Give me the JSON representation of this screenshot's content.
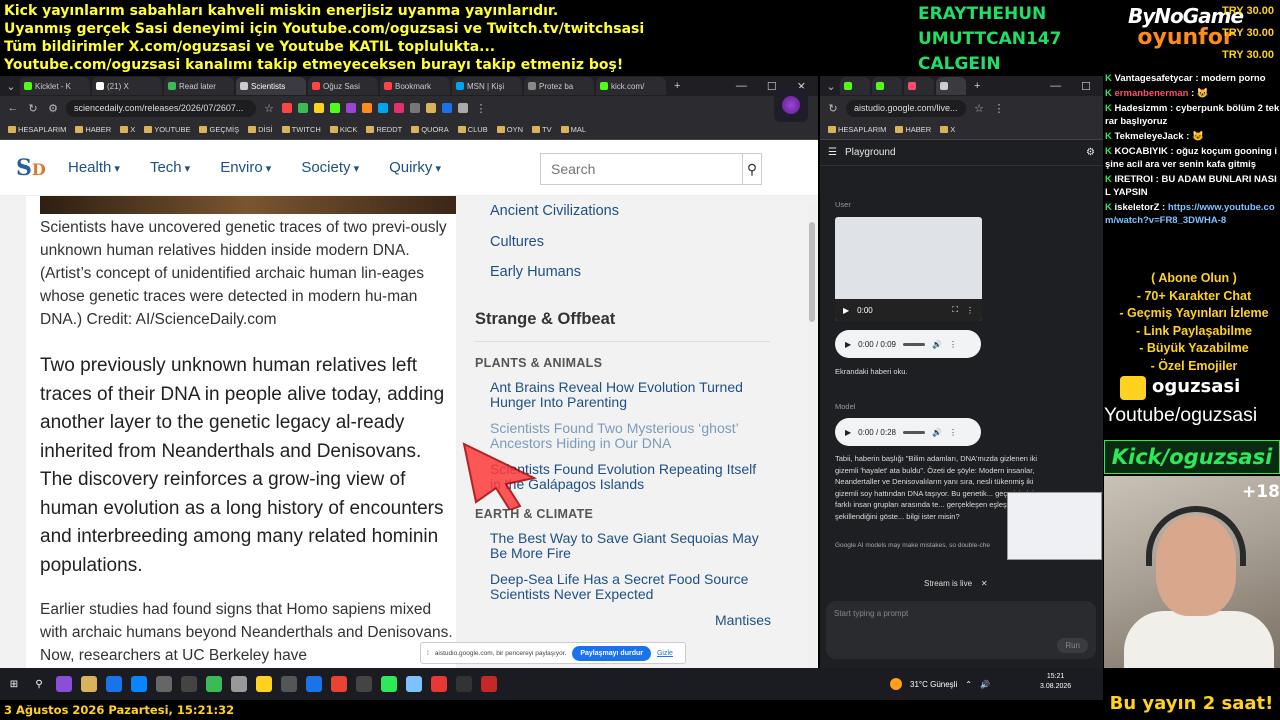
{
  "banner": {
    "lines": [
      "Kick yayınlarım sabahları kahveli miskin enerjisiz uyanma yayınlarıdır.",
      "Uyanmış gerçek Sasi deneyimi için Youtube.com/oguzsasi ve Twitch.tv/twitchsasi",
      "Tüm bildirimler X.com/oguzsasi ve Youtube KATIL toplulukta...",
      "Youtube.com/oguzsasi kanalımı takip etmeyeceksen burayı takip etmeniz boş!"
    ]
  },
  "subscribers": [
    "ERAYTHEHUN",
    "UMUTTCAN147",
    "CALGEIN"
  ],
  "brand": {
    "top": "ByNoGame",
    "bottom": "oyunfor"
  },
  "donations": [
    "TRY 30.00",
    "TRY 30.00",
    "TRY 30.00"
  ],
  "left_browser": {
    "tabs": [
      {
        "label": "Kicklet - K",
        "color": "#53fc18"
      },
      {
        "label": "(21) X",
        "color": "#ffffff"
      },
      {
        "label": "Read later",
        "color": "#3cba54"
      },
      {
        "label": "Scientists",
        "color": "#cccccc",
        "active": true
      },
      {
        "label": "Oğuz Sasi",
        "color": "#ff4444"
      },
      {
        "label": "Bookmark",
        "color": "#ff4444"
      },
      {
        "label": "MSN | Kişi",
        "color": "#00a4ef"
      },
      {
        "label": "Protez ba",
        "color": "#888888"
      },
      {
        "label": "kick.com/",
        "color": "#53fc18"
      }
    ],
    "url": "sciencedaily.com/releases/2026/07/2607...",
    "bookmarks": [
      "HESAPLARIM",
      "HABER",
      "X",
      "YOUTUBE",
      "GEÇMİŞ",
      "DİSİ",
      "TWITCH",
      "KICK",
      "REDDT",
      "QUORA",
      "CLUB",
      "OYN",
      "TV",
      "MAL"
    ]
  },
  "site": {
    "logo_s": "S",
    "logo_d": "D",
    "nav": [
      "Health",
      "Tech",
      "Enviro",
      "Society",
      "Quirky"
    ],
    "search_placeholder": "Search",
    "caption": "Scientists have uncovered genetic traces of two previ-ously unknown human relatives hidden inside modern DNA. (Artist’s concept of unidentified archaic human lin-eages whose genetic traces were detected in modern hu-man DNA.) Credit: AI/ScienceDaily.com",
    "lead": "Two previously unknown human relatives left traces of their DNA in people alive today, adding another layer to the genetic legacy al-ready inherited from Neanderthals and Denisovans. The discovery reinforces a grow-ing view of human evolution as a long history of encounters and interbreeding among many related hominin populations.",
    "body": "Earlier studies had found signs that Homo sapiens mixed with archaic humans beyond Neanderthals and Denisovans. Now, researchers at UC Berkeley have",
    "topic_links": [
      "Ancient Civilizations",
      "Cultures",
      "Early Humans"
    ],
    "section_title": "Strange & Offbeat",
    "plants_heading": "PLANTS & ANIMALS",
    "plants_links": [
      "Ant Brains Reveal How Evolution Turned Hunger Into Parenting",
      "Scientists Found Two Mysterious ‘ghost’ Ancestors Hiding in Our DNA",
      "Scientists Found Evolution Repeating Itself in the Galápagos Islands"
    ],
    "earth_heading": "EARTH & CLIMATE",
    "earth_links": [
      "The Best Way to Save Giant Sequoias May Be More Fire",
      "Deep-Sea Life Has a Secret Food Source Scientists Never Expected",
      "Mantises"
    ]
  },
  "share_bar": {
    "text": "aistudio.google.com, bir pencereyi paylaşıyor.",
    "stop_label": "Paylaşmayı durdur",
    "hide_label": "Gizle"
  },
  "right_browser": {
    "url": "aistudio.google.com/live...",
    "bookmarks": [
      "HESAPLARIM",
      "HABER",
      "X"
    ],
    "title": "Playground",
    "user_label": "User",
    "video_time": "0:00",
    "audio1_time": "0:00 / 0:09",
    "user_text": "Ekrandaki haberi oku.",
    "model_label": "Model",
    "audio2_time": "0:00 / 0:28",
    "model_text": "Tabii, haberin başlığı \"Bilim adamları, DNA'mızda gizlenen iki gizemli 'hayalet' ata buldu\". Özeti de şöyle: Modern insanlar, Neandertaller ve Denisovalıların yanı sıra, nesli tükenmiş iki gizemli soy hattından DNA taşıyor. Bu genetik... geçmişimizin farklı insan grupları arasında te... gerçekleşen eşleşmelerle şekillendiğini göste... bilgi ister misin?",
    "disclaimer": "Google AI models may make mistakes, so double-che",
    "stream_live": "Stream is live",
    "prompt_placeholder": "Start typing a prompt",
    "run_label": "Run"
  },
  "chat": [
    {
      "user": "Vantagesafetycar",
      "color": "#ffffff",
      "text": "modern porno"
    },
    {
      "user": "ermanbenerman",
      "color": "#ff4d6a",
      "text": "😺"
    },
    {
      "user": "Hadesizmm",
      "color": "#ffffff",
      "text": "cyberpunk bölüm 2 tekrar başlıyoruz"
    },
    {
      "user": "TekmeleyeJack",
      "color": "#ffffff",
      "text": "😺"
    },
    {
      "user": "KOCABIYIK",
      "color": "#ffffff",
      "text": "oğuz koçum gooning işine acil ara ver senin kafa gitmiş"
    },
    {
      "user": "IRETROI",
      "color": "#ffffff",
      "text": "BU ADAM BUNLARI NASIL YAPSIN"
    },
    {
      "user": "iskeletorZ",
      "color": "#ffffff",
      "text": "https://www.youtube.com/watch?v=FR8_3DWHA-8",
      "link": true
    }
  ],
  "promo": [
    "( Abone Olun )",
    "- 70+ Karakter Chat",
    "- Geçmiş Yayınları İzleme",
    "- Link Paylaşabilme",
    "- Büyük Yazabilme",
    "- Özel Emojiler"
  ],
  "socials": {
    "name": "oguzsasi",
    "youtube": "Youtube/oguzsasi",
    "kick": "Kick/oguzsasi"
  },
  "viewer_extra": "+18",
  "tray": {
    "weather": "31°C  Güneşli",
    "time": "15:21",
    "date": "3.08.2026"
  },
  "bottom": {
    "date_line": "3 Ağustos 2026 Pazartesi, 15:21:32",
    "notice": "Bu yayın 2 saat!"
  }
}
